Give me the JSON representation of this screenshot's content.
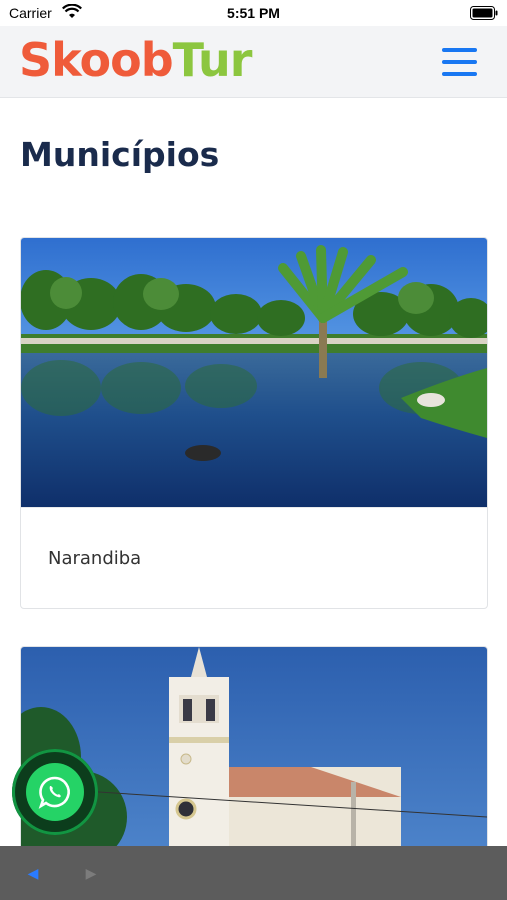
{
  "status_bar": {
    "carrier": "Carrier",
    "time": "5:51 PM"
  },
  "header": {
    "logo_part1": "Skoob",
    "logo_part2": "Tur",
    "menu_icon": "hamburger-menu-icon"
  },
  "page": {
    "title": "Municípios"
  },
  "cards": [
    {
      "title": "Narandiba",
      "image": "lake-with-palm-trees-and-ducks"
    },
    {
      "title": "",
      "image": "white-church-tower-blue-sky"
    }
  ],
  "floating": {
    "icon": "whatsapp-icon"
  },
  "bottom_nav": {
    "back_icon": "back-arrow-icon",
    "forward_icon": "forward-arrow-icon"
  },
  "colors": {
    "brand_orange": "#ef5b3a",
    "brand_green": "#8cc63f",
    "menu_blue": "#1877f2",
    "title_navy": "#1a2b4c",
    "whatsapp": "#25d366"
  }
}
